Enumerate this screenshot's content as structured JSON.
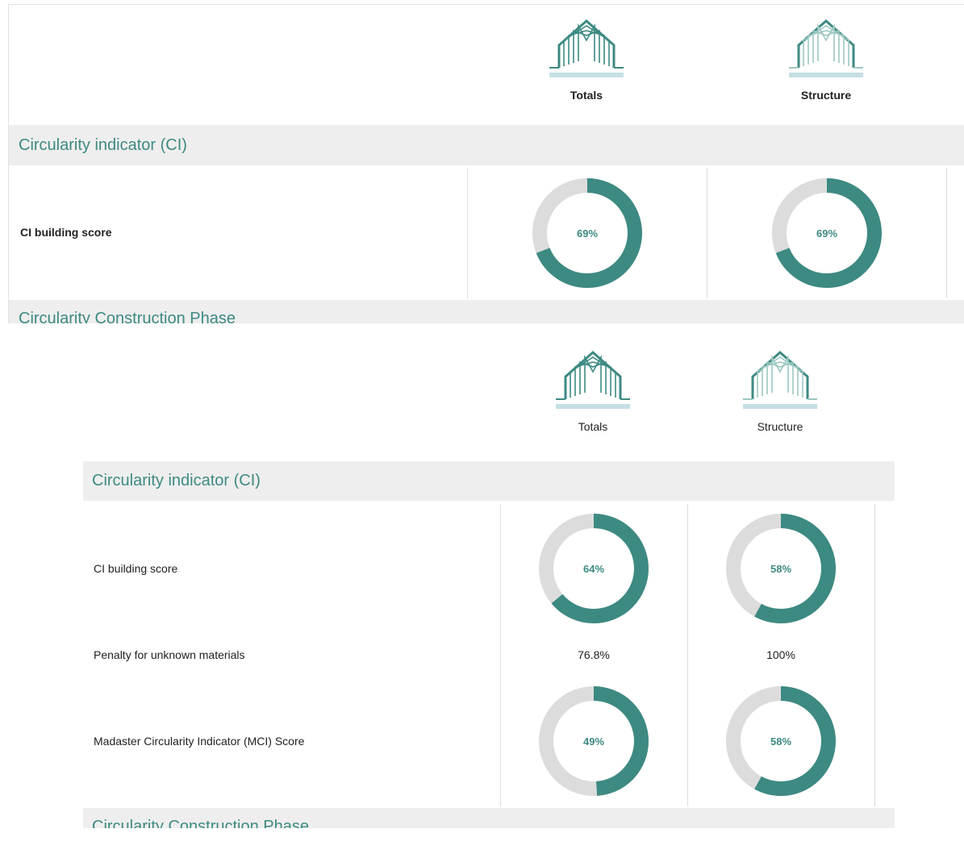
{
  "colors": {
    "accent": "#3d8a82",
    "track": "#dcdcdc",
    "section_bg": "#eeeeee"
  },
  "top": {
    "columns": [
      {
        "label": "Totals",
        "icon": "house-totals-icon"
      },
      {
        "label": "Structure",
        "icon": "house-structure-icon"
      }
    ],
    "section_title": "Circularity indicator (CI)",
    "rows": [
      {
        "label": "CI building score",
        "values": [
          69,
          69
        ],
        "value_labels": [
          "69%",
          "69%"
        ]
      }
    ],
    "next_section_title": "Circularity Construction Phase"
  },
  "bottom": {
    "columns": [
      {
        "label": "Totals",
        "icon": "house-totals-icon"
      },
      {
        "label": "Structure",
        "icon": "house-structure-icon"
      }
    ],
    "section_title": "Circularity indicator (CI)",
    "rows": [
      {
        "label": "CI building score",
        "values": [
          64,
          58
        ],
        "value_labels": [
          "64%",
          "58%"
        ]
      },
      {
        "label": "Penalty for unknown materials",
        "value_labels": [
          "76.8%",
          "100%"
        ]
      },
      {
        "label": "Madaster Circularity Indicator (MCI) Score",
        "values": [
          49,
          58
        ],
        "value_labels": [
          "49%",
          "58%"
        ]
      }
    ],
    "next_section_title": "Circularity Construction Phase"
  }
}
